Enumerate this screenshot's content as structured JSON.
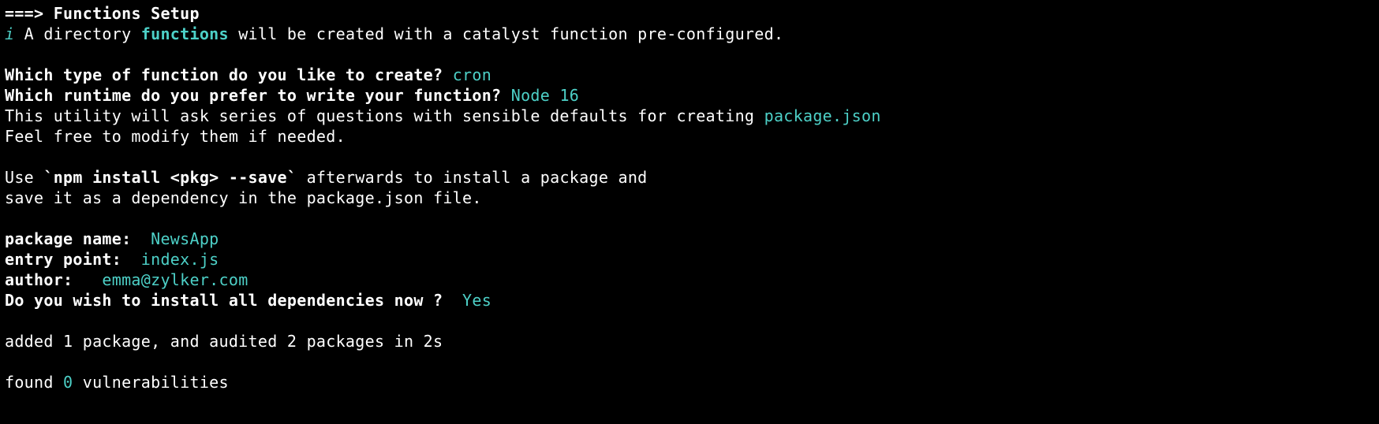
{
  "header": {
    "arrow": "===> ",
    "title": "Functions Setup"
  },
  "info": {
    "symbol": "i",
    "text_before": " A directory ",
    "highlight": "functions",
    "text_after": " will be created with a catalyst function pre-configured."
  },
  "prompts": {
    "function_type": {
      "question": "Which type of function do you like to create? ",
      "answer": "cron"
    },
    "runtime": {
      "question": "Which runtime do you prefer to write your function? ",
      "answer": "Node 16"
    }
  },
  "utility_msg": {
    "line1_before": "This utility will ask series of questions with sensible defaults for creating ",
    "line1_highlight": "package.json",
    "line2": "Feel free to modify them if needed."
  },
  "npm_msg": {
    "line1_before": "Use ",
    "line1_bold": "`npm install <pkg> --save`",
    "line1_after": " afterwards to install a package and",
    "line2": "save it as a dependency in the package.json file."
  },
  "package_prompts": {
    "name": {
      "label": "package name:",
      "value": "  NewsApp"
    },
    "entry": {
      "label": "entry point:",
      "value": "  index.js"
    },
    "author": {
      "label": "author:",
      "value": "   emma@zylker.com"
    },
    "install": {
      "label": "Do you wish to install all dependencies now ?",
      "value": "  Yes"
    }
  },
  "results": {
    "added": "added 1 package, and audited 2 packages in 2s",
    "found_before": "found ",
    "found_count": "0",
    "found_after": " vulnerabilities"
  }
}
